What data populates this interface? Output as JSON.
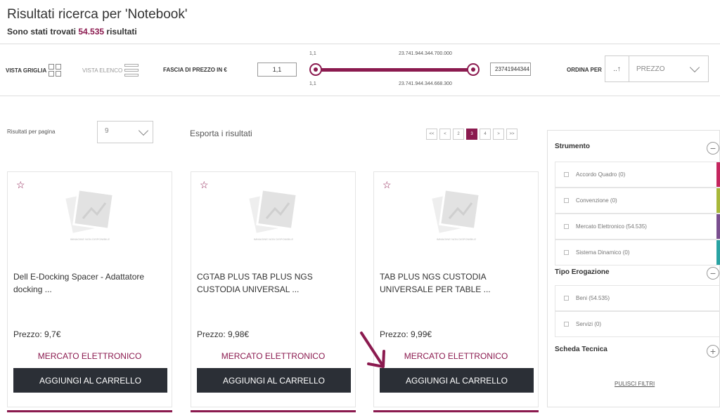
{
  "header": {
    "title": "Risultati ricerca per 'Notebook'",
    "subtitle_prefix": "Sono stati trovati",
    "result_count": "54.535",
    "subtitle_suffix": "risultati"
  },
  "toolbar": {
    "grid_view": "VISTA GRIGLIA",
    "list_view": "VISTA ELENCO",
    "price_range_label": "FASCIA DI PREZZO IN €",
    "price_min_value": "1,1",
    "price_max_value": "23741944344",
    "slider_top_min": "1,1",
    "slider_top_max": "23.741.944.344.700.000",
    "slider_bottom_min": "1,1",
    "slider_bottom_max": "23.741.944.344.668.300",
    "sort_label": "ORDINA PER",
    "sort_value": "PREZZO"
  },
  "results_bar": {
    "per_page_label": "Risultati per pagina",
    "per_page_value": "9",
    "export_label": "Esporta i risultati",
    "pages": [
      "<<",
      "<",
      "2",
      "3",
      "4",
      ">",
      ">>"
    ],
    "active_page": "3"
  },
  "products": [
    {
      "name": "Dell E-Docking Spacer - Adattatore docking ...",
      "price": "Prezzo: 9,7€",
      "market": "MERCATO ELETTRONICO",
      "cart": "AGGIUNGI AL CARRELLO"
    },
    {
      "name": "CGTAB PLUS TAB PLUS NGS CUSTODIA UNIVERSAL ...",
      "price": "Prezzo: 9,98€",
      "market": "MERCATO ELETTRONICO",
      "cart": "AGGIUNGI AL CARRELLO"
    },
    {
      "name": "TAB PLUS NGS CUSTODIA UNIVERSALE PER TABLE ...",
      "price": "Prezzo: 9,99€",
      "market": "MERCATO ELETTRONICO",
      "cart": "AGGIUNGI AL CARRELLO"
    }
  ],
  "image_placeholder_text": "IMMAGINE NON DISPONIBILE",
  "filters": {
    "strumento_label": "Strumento",
    "strumento_items": [
      "Accordo Quadro (0)",
      "Convenzione (0)",
      "Mercato Elettronico (54.535)",
      "Sistema Dinamico (0)"
    ],
    "strumento_colors": [
      "#c4265e",
      "#a8b83a",
      "#7a4f8f",
      "#2aa3a3"
    ],
    "erogazione_label": "Tipo Erogazione",
    "erogazione_items": [
      "Beni (54.535)",
      "Servizi (0)"
    ],
    "scheda_label": "Scheda Tecnica",
    "clear_label": "PULISCI FILTRI"
  },
  "colors": {
    "accent": "#8b1a4f",
    "button": "#2b2f36"
  }
}
